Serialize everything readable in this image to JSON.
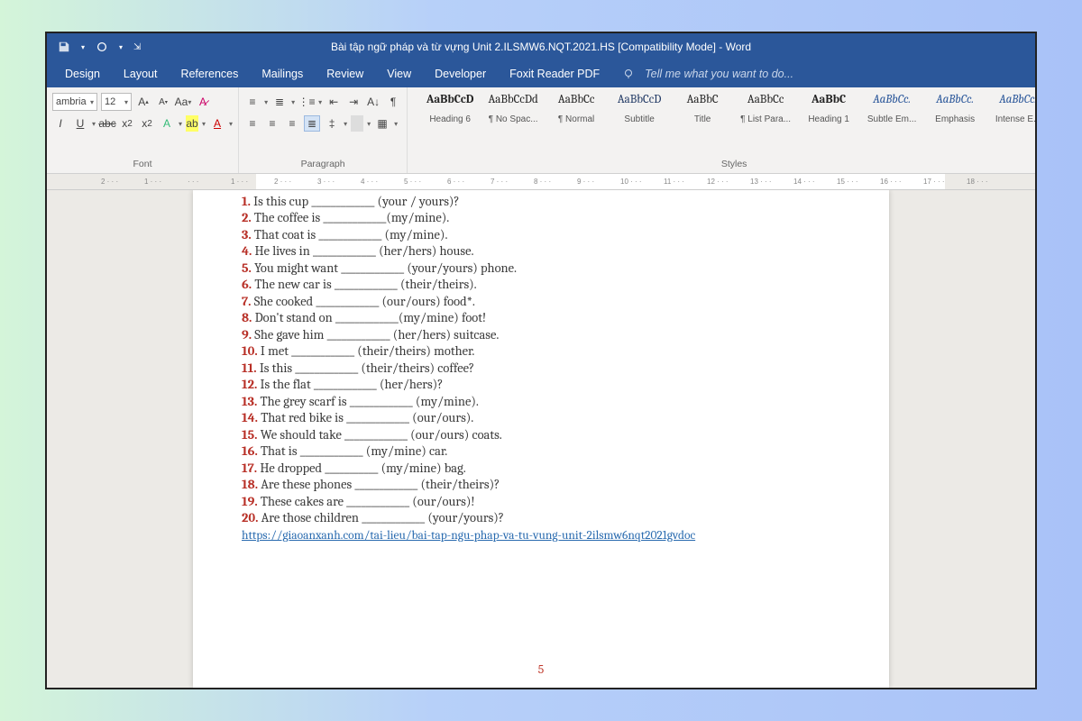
{
  "titlebar": {
    "title": "Bài tập ngữ pháp và từ vựng Unit 2.ILSMW6.NQT.2021.HS [Compatibility Mode] - Word"
  },
  "tabs": {
    "design": "Design",
    "layout": "Layout",
    "references": "References",
    "mailings": "Mailings",
    "review": "Review",
    "view": "View",
    "developer": "Developer",
    "foxit": "Foxit Reader PDF",
    "tell": "Tell me what you want to do..."
  },
  "ribbon": {
    "font_name": "ambria",
    "font_size": "12",
    "group_font": "Font",
    "group_paragraph": "Paragraph",
    "group_styles": "Styles",
    "styles": [
      {
        "preview": "AaBbCcD",
        "name": "Heading 6",
        "cls": "dark bold"
      },
      {
        "preview": "AaBbCcDd",
        "name": "¶ No Spac...",
        "cls": "dark"
      },
      {
        "preview": "AaBbCc",
        "name": "¶ Normal",
        "cls": "dark"
      },
      {
        "preview": "AaBbCcD",
        "name": "Subtitle",
        "cls": ""
      },
      {
        "preview": "AaBbC",
        "name": "Title",
        "cls": "dark"
      },
      {
        "preview": "AaBbCc",
        "name": "¶ List Para...",
        "cls": "dark"
      },
      {
        "preview": "AaBbC",
        "name": "Heading 1",
        "cls": "dark bold"
      },
      {
        "preview": "AaBbCc.",
        "name": "Subtle Em...",
        "cls": "italic"
      },
      {
        "preview": "AaBbCc.",
        "name": "Emphasis",
        "cls": "italic"
      },
      {
        "preview": "AaBbCc.",
        "name": "Intense E...",
        "cls": "italic"
      }
    ]
  },
  "ruler": [
    "2",
    "1",
    "",
    "1",
    "2",
    "3",
    "4",
    "5",
    "6",
    "7",
    "8",
    "9",
    "10",
    "11",
    "12",
    "13",
    "14",
    "15",
    "16",
    "17",
    "18"
  ],
  "doc": {
    "lines": [
      {
        "n": "1.",
        "t": " Is this cup _____________ (your / yours)?"
      },
      {
        "n": "2.",
        "t": " The coffee is _____________(my/mine)."
      },
      {
        "n": "3.",
        "t": " That coat is _____________ (my/mine)."
      },
      {
        "n": "4.",
        "t": " He lives in _____________ (her/hers) house."
      },
      {
        "n": "5.",
        "t": " You might want _____________ (your/yours) phone."
      },
      {
        "n": "6.",
        "t": " The new car is _____________ (their/theirs)."
      },
      {
        "n": "7.",
        "t": " She cooked _____________ (our/ours) food*."
      },
      {
        "n": "8.",
        "t": " Don't stand on _____________(my/mine) foot!"
      },
      {
        "n": "9.",
        "t": " She gave him _____________ (her/hers) suitcase."
      },
      {
        "n": "10.",
        "t": " I met _____________ (their/theirs) mother."
      },
      {
        "n": "11.",
        "t": " Is this _____________ (their/theirs) coffee?"
      },
      {
        "n": "12.",
        "t": " Is the flat _____________ (her/hers)?"
      },
      {
        "n": "13.",
        "t": " The grey scarf is _____________ (my/mine)."
      },
      {
        "n": "14.",
        "t": " That red bike is _____________ (our/ours)."
      },
      {
        "n": "15.",
        "t": " We should take _____________ (our/ours) coats."
      },
      {
        "n": "16.",
        "t": " That is _____________ (my/mine) car."
      },
      {
        "n": "17.",
        "t": " He dropped ___________ (my/mine) bag."
      },
      {
        "n": "18.",
        "t": " Are these phones _____________ (their/theirs)?"
      },
      {
        "n": "19.",
        "t": " These cakes are _____________ (our/ours)!"
      },
      {
        "n": "20.",
        "t": " Are those children _____________ (your/yours)?"
      }
    ],
    "link": "https://giaoanxanh.com/tai-lieu/bai-tap-ngu-phap-va-tu-vung-unit-2ilsmw6nqt2021gvdoc",
    "page_number": "5"
  }
}
